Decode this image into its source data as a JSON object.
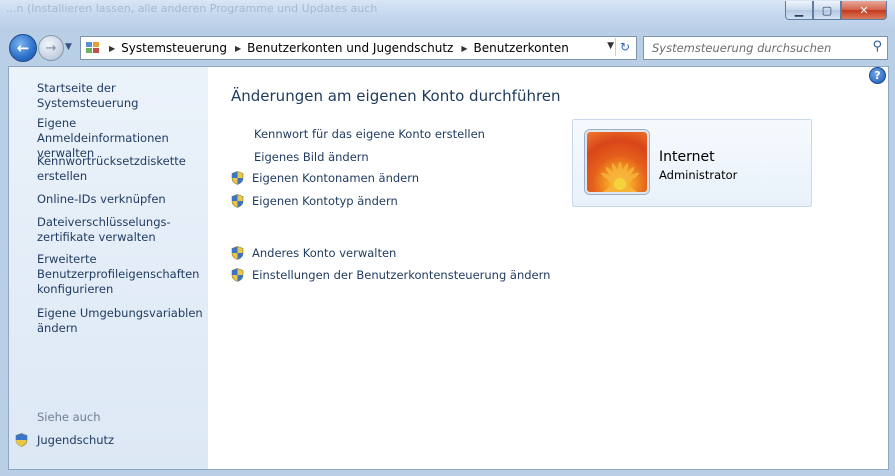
{
  "titlebar": {
    "background_text": "...n (Installieren lassen, alle anderen Programme und Updates auch",
    "minimize": "▁",
    "maximize": "▢",
    "close": "✕"
  },
  "nav": {
    "back": "←",
    "forward": "→",
    "breadcrumbs": [
      "Systemsteuerung",
      "Benutzerkonten und Jugendschutz",
      "Benutzerkonten"
    ],
    "search_placeholder": "Systemsteuerung durchsuchen"
  },
  "sidebar": {
    "home": "Startseite der Systemsteuerung",
    "items": [
      "Eigene Anmeldeinformationen verwalten",
      "Kennwortrücksetzdiskette erstellen",
      "Online-IDs verknüpfen",
      "Dateiverschlüsselungs-zertifikate verwalten",
      "Erweiterte Benutzerprofileigenschaften konfigurieren",
      "Eigene Umgebungsvariablen ändern"
    ],
    "see_also": "Siehe auch",
    "parental": "Jugendschutz"
  },
  "main": {
    "title": "Änderungen am eigenen Konto durchführen",
    "tasks": [
      "Kennwort für das eigene Konto erstellen",
      "Eigenes Bild ändern",
      "Eigenen Kontonamen ändern",
      "Eigenen Kontotyp ändern"
    ],
    "other_tasks": [
      "Anderes Konto verwalten",
      "Einstellungen der Benutzerkontensteuerung ändern"
    ],
    "help": "?"
  },
  "account": {
    "name": "Internet",
    "role": "Administrator"
  }
}
